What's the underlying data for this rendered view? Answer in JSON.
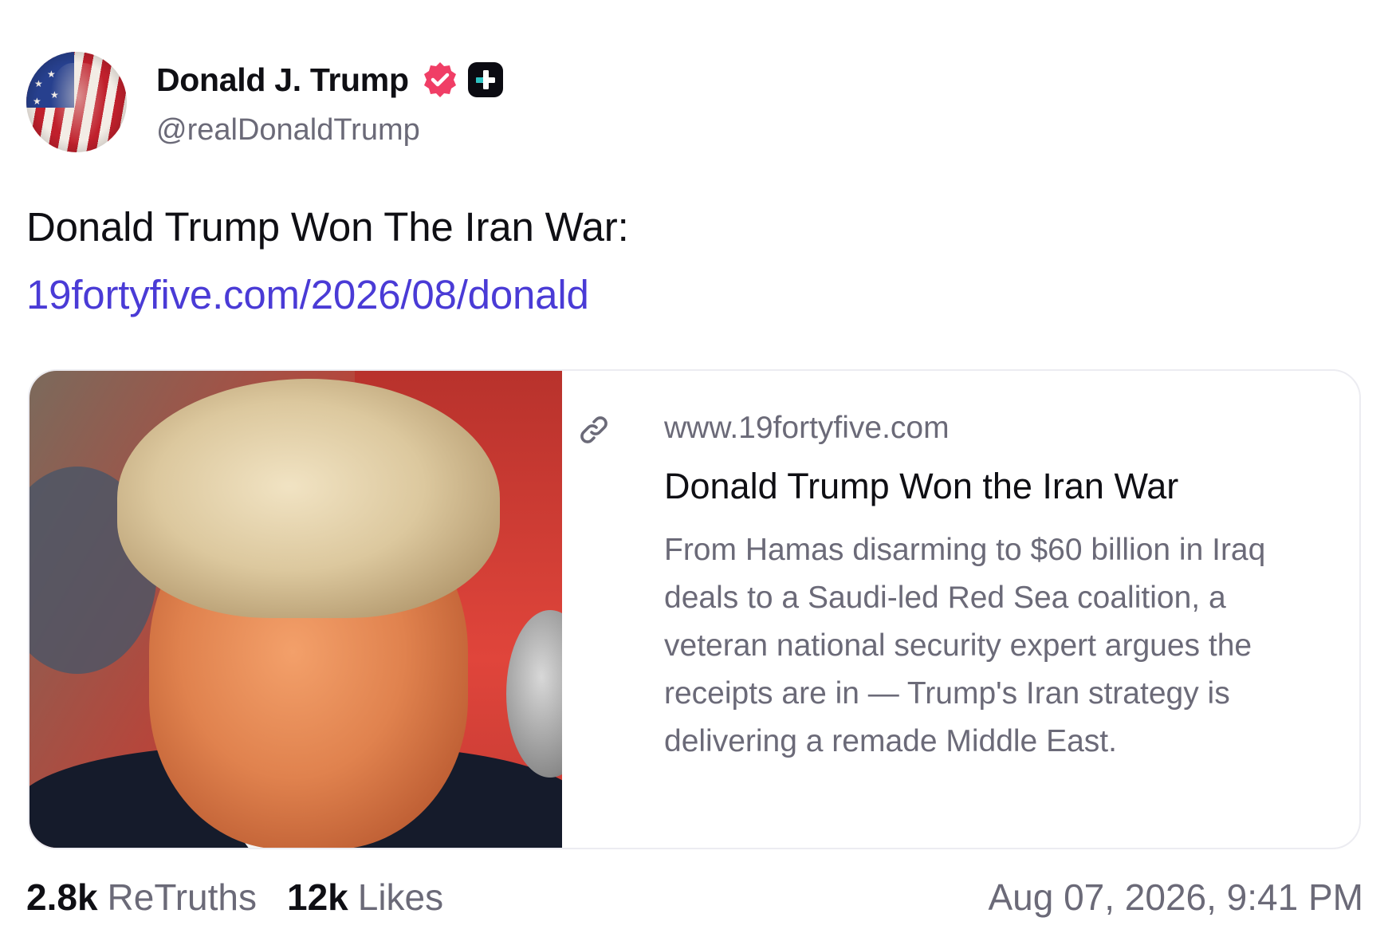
{
  "author": {
    "display_name": "Donald J. Trump",
    "handle": "@realDonaldTrump",
    "verified_icon": "verified-badge-icon",
    "plus_icon": "plus-badge-icon",
    "verified_color": "#f03e66"
  },
  "post": {
    "text": "Donald Trump Won The Iran War:",
    "link_text": "19fortyfive.com/2026/08/donald",
    "link_color": "#4a3bd6"
  },
  "link_card": {
    "domain": "www.19fortyfive.com",
    "title": "Donald Trump Won the Iran War",
    "description": "From Hamas disarming to $60 billion in Iraq deals to a Saudi-led Red Sea coalition, a veteran national security expert argues the receipts are in — Trump's Iran strategy is delivering a remade Middle East.",
    "icon": "link-icon"
  },
  "stats": {
    "retruths_count": "2.8k",
    "retruths_label": "ReTruths",
    "likes_count": "12k",
    "likes_label": "Likes"
  },
  "timestamp": "Aug 07, 2026, 9:41 PM"
}
